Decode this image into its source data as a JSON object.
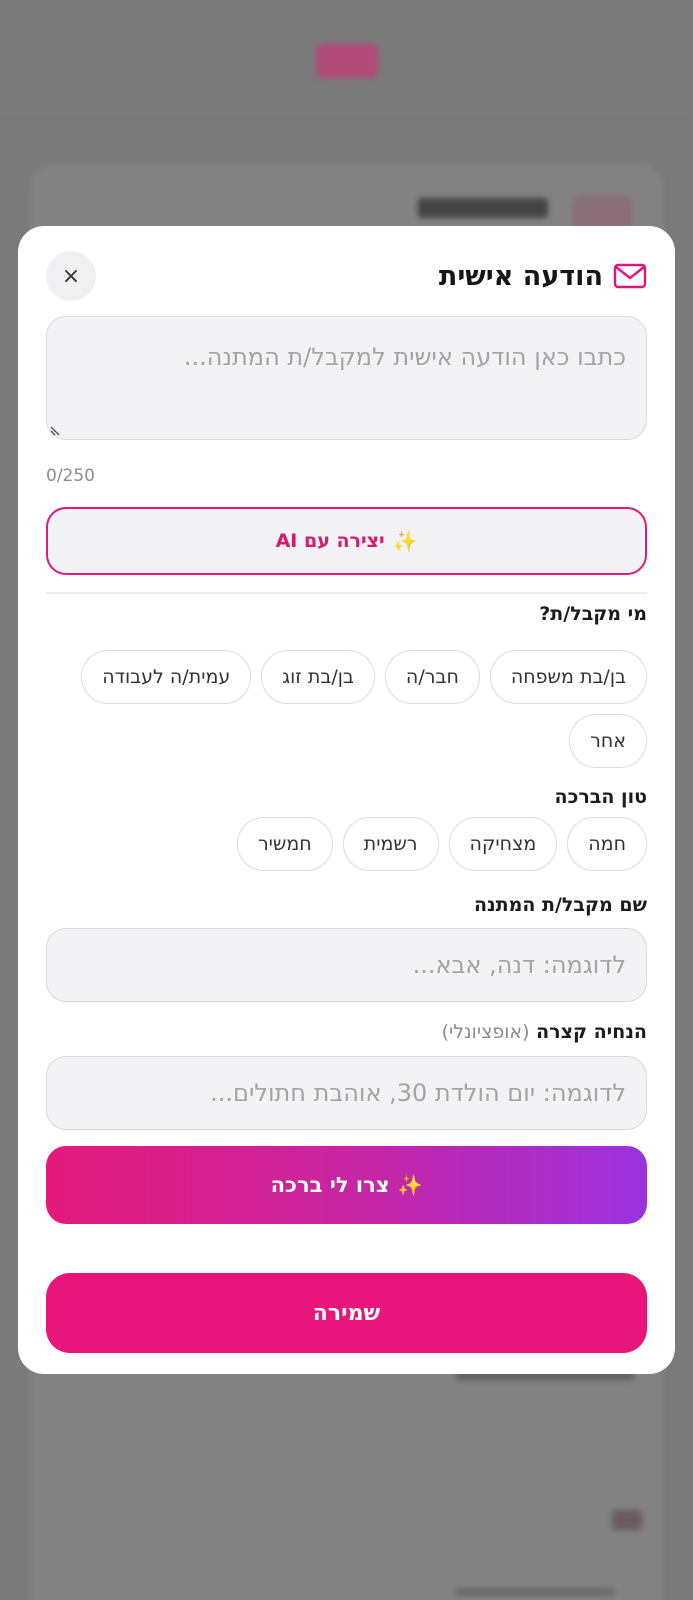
{
  "modal": {
    "title": "הודעה אישית",
    "close_label": "×",
    "message_placeholder": "כתבו כאן הודעה אישית למקבל/ת המתנה...",
    "char_counter": "0/250",
    "ai_button": {
      "icon": "✨",
      "label": "יצירה עם AI"
    },
    "recipient": {
      "label": "מי מקבל/ת?",
      "options": [
        "בן/בת משפחה",
        "חבר/ה",
        "בן/בת זוג",
        "עמית/ה לעבודה",
        "אחר"
      ]
    },
    "tone": {
      "label": "טון הברכה",
      "options": [
        "חמה",
        "מצחיקה",
        "רשמית",
        "חמשיר"
      ]
    },
    "name_field": {
      "label": "שם מקבל/ת המתנה",
      "placeholder": "לדוגמה: דנה, אבא..."
    },
    "hint_field": {
      "label": "הנחיה קצרה",
      "optional": "(אופציונלי)",
      "placeholder": "לדוגמה: יום הולדת 30, אוהבת חתולים..."
    },
    "generate_button": {
      "icon": "✨",
      "label": "צרו לי ברכה"
    },
    "save_button": "שמירה"
  },
  "colors": {
    "accent": "#e8167a",
    "gradient_start": "#e51a7a",
    "gradient_end": "#9a32df",
    "overlay": "#7b7b7b"
  },
  "icons": {
    "title_icon": "mail-icon",
    "close_icon": "close-icon",
    "sparkle_icon": "sparkle-icon"
  }
}
